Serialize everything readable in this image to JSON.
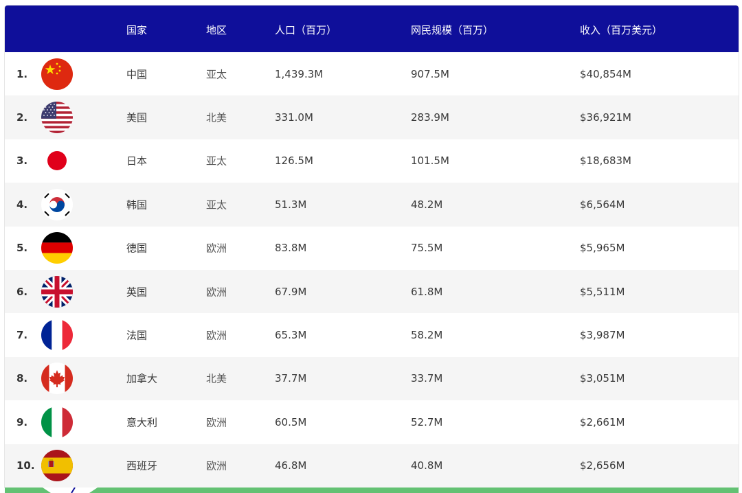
{
  "table": {
    "headers": {
      "country": "国家",
      "region": "地区",
      "population": "人口（百万）",
      "netizens": "网民规模（百万）",
      "revenue": "收入（百万美元）"
    },
    "rows": [
      {
        "rank": "1.",
        "flag": "china-flag-icon",
        "country": "中国",
        "region": "亚太",
        "population": "1,439.3M",
        "netizens": "907.5M",
        "revenue": "$40,854M"
      },
      {
        "rank": "2.",
        "flag": "usa-flag-icon",
        "country": "美国",
        "region": "北美",
        "population": "331.0M",
        "netizens": "283.9M",
        "revenue": "$36,921M"
      },
      {
        "rank": "3.",
        "flag": "japan-flag-icon",
        "country": "日本",
        "region": "亚太",
        "population": "126.5M",
        "netizens": "101.5M",
        "revenue": "$18,683M"
      },
      {
        "rank": "4.",
        "flag": "korea-flag-icon",
        "country": "韩国",
        "region": "亚太",
        "population": "51.3M",
        "netizens": "48.2M",
        "revenue": "$6,564M"
      },
      {
        "rank": "5.",
        "flag": "germany-flag-icon",
        "country": "德国",
        "region": "欧洲",
        "population": "83.8M",
        "netizens": "75.5M",
        "revenue": "$5,965M"
      },
      {
        "rank": "6.",
        "flag": "uk-flag-icon",
        "country": "英国",
        "region": "欧洲",
        "population": "67.9M",
        "netizens": "61.8M",
        "revenue": "$5,511M"
      },
      {
        "rank": "7.",
        "flag": "france-flag-icon",
        "country": "法国",
        "region": "欧洲",
        "population": "65.3M",
        "netizens": "58.2M",
        "revenue": "$3,987M"
      },
      {
        "rank": "8.",
        "flag": "canada-flag-icon",
        "country": "加拿大",
        "region": "北美",
        "population": "37.7M",
        "netizens": "33.7M",
        "revenue": "$3,051M"
      },
      {
        "rank": "9.",
        "flag": "italy-flag-icon",
        "country": "意大利",
        "region": "欧洲",
        "population": "60.5M",
        "netizens": "52.7M",
        "revenue": "$2,661M"
      },
      {
        "rank": "10.",
        "flag": "spain-flag-icon",
        "country": "西班牙",
        "region": "欧洲",
        "population": "46.8M",
        "netizens": "40.8M",
        "revenue": "$2,656M"
      }
    ]
  },
  "colors": {
    "header_bg": "#0f0f9a",
    "row_alt_bg": "#f5f5f5",
    "footer_strip": "#63c173"
  }
}
